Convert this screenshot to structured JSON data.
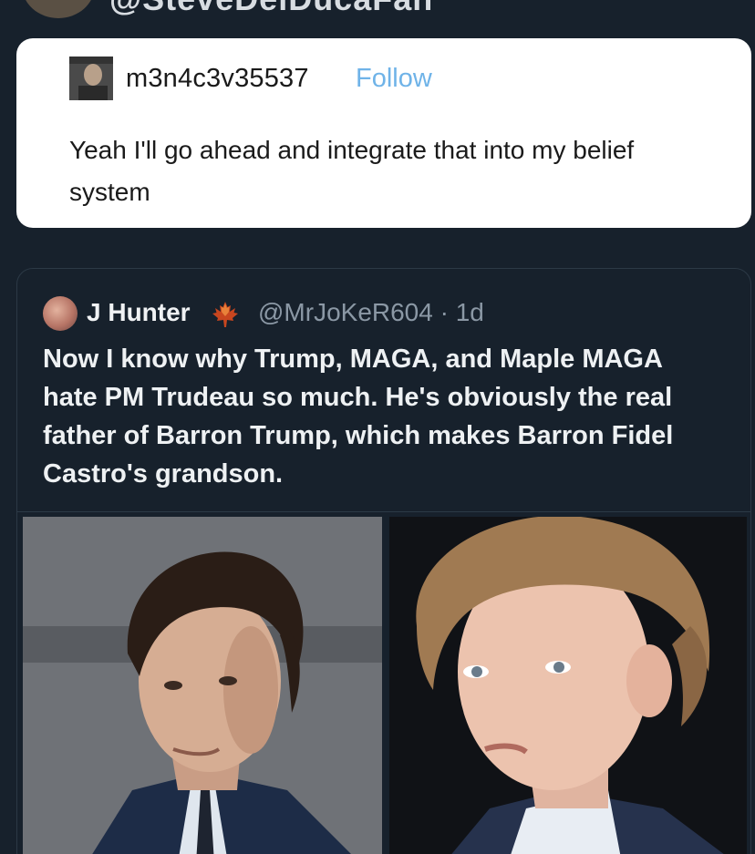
{
  "top_header": {
    "handle_fragment": "@SteveDelDucaFan"
  },
  "tumblr_post": {
    "username": "m3n4c3v35537",
    "follow_label": "Follow",
    "text": "Yeah I'll go ahead and integrate that into my belief system"
  },
  "quoted_tweet": {
    "display_name": "J Hunter",
    "name_emoji_icon": "maple-leaf-icon",
    "handle_and_time": "@MrJoKeR604 · 1d",
    "text": "Now I know why Trump, MAGA, and Maple MAGA hate PM Trudeau so much. He's obviously the real father of Barron Trump, which makes Barron Fidel Castro's grandson.",
    "images": [
      "left-portrait",
      "right-portrait"
    ]
  },
  "colors": {
    "background": "#17212c",
    "card_white": "#ffffff",
    "follow_blue": "#6fb3e8",
    "tweet_text": "#eef1f3",
    "muted_text": "#8b98a5",
    "border": "#2c3946",
    "maple_red": "#c8461f"
  }
}
